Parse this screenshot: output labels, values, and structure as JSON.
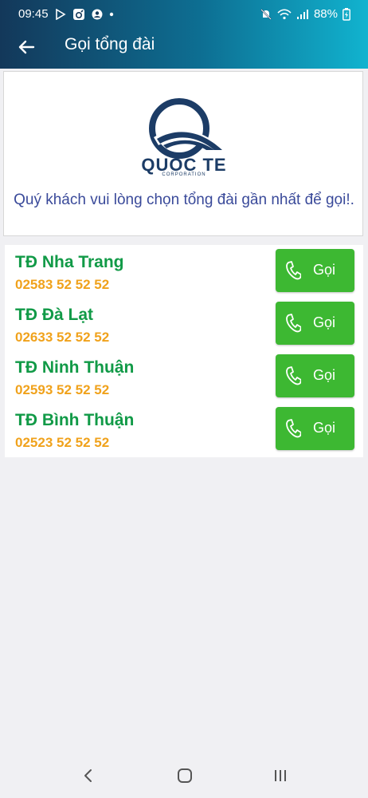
{
  "status": {
    "time": "09:45",
    "battery": "88%"
  },
  "appbar": {
    "title": "Gọi tổng đài"
  },
  "brand": {
    "name": "QUOC TE",
    "subtitle": "CORPORATION",
    "color": "#1c3c66"
  },
  "message": "Quý khách vui lòng chọn tổng đài gần nhất để gọi!.",
  "call_label": "Gọi",
  "hotlines": [
    {
      "name": "TĐ Nha Trang",
      "phone": "02583 52 52 52"
    },
    {
      "name": "TĐ Đà Lạt",
      "phone": "02633 52 52 52"
    },
    {
      "name": "TĐ Ninh Thuận",
      "phone": "02593 52 52 52"
    },
    {
      "name": "TĐ Bình Thuận",
      "phone": "02523 52 52 52"
    }
  ],
  "colors": {
    "name": "#119a47",
    "phone": "#f0a21c",
    "button": "#3db832",
    "message": "#3a4a9a"
  },
  "icons": {
    "back": "arrow-left-icon",
    "call": "phone-icon",
    "nav_back": "chevron-left-icon",
    "nav_home": "home-icon",
    "nav_recent": "recent-apps-icon"
  }
}
